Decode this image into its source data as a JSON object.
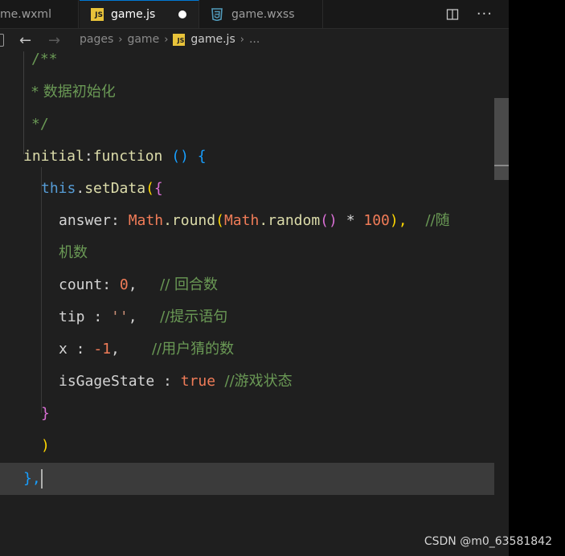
{
  "tabs": [
    {
      "label": "me.wxml",
      "active": false
    },
    {
      "label": "game.js",
      "active": true,
      "unsaved": true
    },
    {
      "label": "game.wxss",
      "active": false
    }
  ],
  "tab_icons": {
    "js": "JS",
    "css": "css-icon"
  },
  "tabbar_actions": {
    "split": "split-editor-icon",
    "more": "···"
  },
  "breadcrumb": {
    "back": "←",
    "forward": "→",
    "items": [
      "pages",
      "game",
      "game.js",
      "..."
    ],
    "separator": "›"
  },
  "code": {
    "l1": "/**",
    "l2": "* 数据初始化",
    "l3": "*/",
    "l4_name": "initial",
    "l4_colon": ":",
    "l4_kw": "function",
    "l4_rest": " () {",
    "l5_this": "this",
    "l5_dot": ".",
    "l5_fn": "setData",
    "l5_paren": "(",
    "l5_brace": "{",
    "l6_key": "answer",
    "l6_colon": ": ",
    "l6_math1": "Math",
    "l6_round": ".round",
    "l6_p1": "(",
    "l6_math2": "Math",
    "l6_random": ".random",
    "l6_p2": "()",
    "l6_mul": " * ",
    "l6_num": "100",
    "l6_p3": "),",
    "l6_cmt": "    //随",
    "l7_cmt": "机数",
    "l8_key": "count",
    "l8_colon": ": ",
    "l8_num": "0",
    "l8_comma": ",",
    "l8_cmt": "     // 回合数",
    "l9_key": "tip",
    "l9_colon": " : ",
    "l9_str": "''",
    "l9_comma": ",",
    "l9_cmt": "     //提示语句",
    "l10_key": "x",
    "l10_colon": " : ",
    "l10_num": "-1",
    "l10_comma": ",",
    "l10_cmt": "       //用户猜的数",
    "l11_key": "isGageState",
    "l11_colon": " : ",
    "l11_bool": "true",
    "l11_cmt": "  //游戏状态",
    "l12": "}",
    "l13": ")",
    "l14": "},"
  },
  "watermark": "CSDN @m0_63581842"
}
